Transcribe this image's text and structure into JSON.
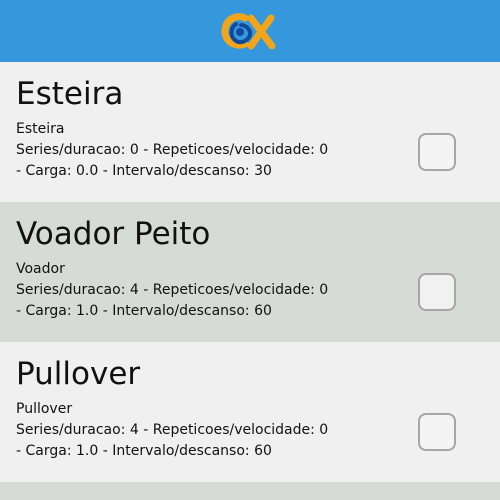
{
  "header": {
    "logo_icon": "ox-logo-icon",
    "background": "#3598dc"
  },
  "exercises": [
    {
      "title": "Esteira",
      "subtitle": "Esteira",
      "details_line1": "Series/duracao: 0 - Repeticoes/velocidade: 0",
      "details_line2": "- Carga: 0.0 - Intervalo/descanso: 30",
      "checked": false
    },
    {
      "title": "Voador Peito",
      "subtitle": "Voador",
      "details_line1": "Series/duracao: 4 - Repeticoes/velocidade: 0",
      "details_line2": "- Carga: 1.0 - Intervalo/descanso: 60",
      "checked": false
    },
    {
      "title": "Pullover",
      "subtitle": "Pullover",
      "details_line1": "Series/duracao: 4 - Repeticoes/velocidade: 0",
      "details_line2": "- Carga: 1.0 - Intervalo/descanso: 60",
      "checked": false
    }
  ],
  "colors": {
    "row_light": "#eff0ef",
    "row_dark": "#d7dbd8",
    "logo_orange": "#f0a51b",
    "logo_blue": "#11499a"
  }
}
